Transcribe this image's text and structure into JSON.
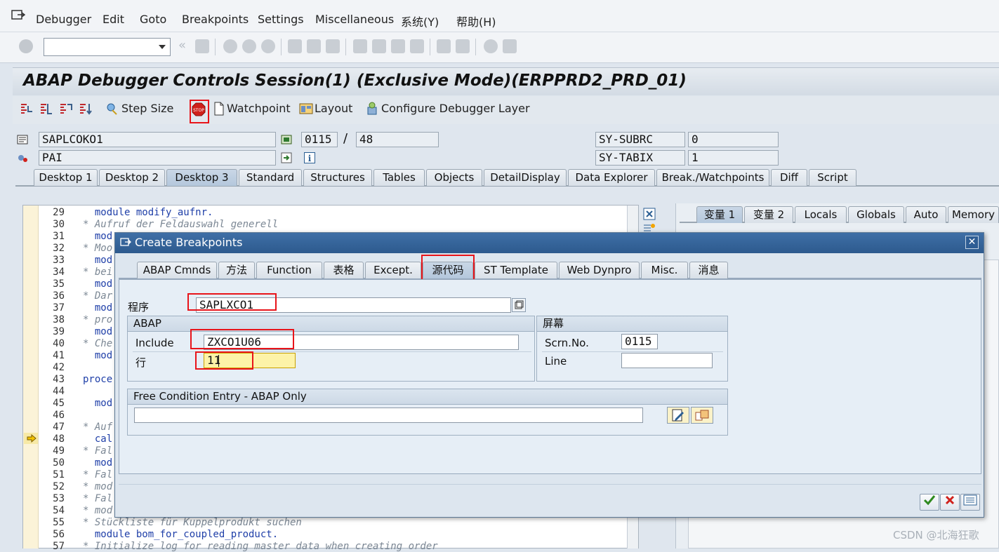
{
  "menubar": {
    "items": [
      "Debugger",
      "Edit",
      "Goto",
      "Breakpoints",
      "Settings",
      "Miscellaneous",
      "系统(Y)",
      "帮助(H)"
    ]
  },
  "toolbar": {
    "command_field": ""
  },
  "title": "ABAP Debugger Controls Session(1)  (Exclusive Mode)(ERPPRD2_PRD_01)",
  "app_toolbar": {
    "step_size": "Step Size",
    "watchpoint": "Watchpoint",
    "layout": "Layout",
    "configure": "Configure Debugger Layer"
  },
  "status": {
    "program": "SAPLCOKO1",
    "event": "PAI",
    "screen": "0115",
    "separator": "/",
    "line": "48",
    "subrc_label": "SY-SUBRC",
    "subrc_value": "0",
    "tabix_label": "SY-TABIX",
    "tabix_value": "1"
  },
  "desktop_tabs": [
    "Desktop 1",
    "Desktop 2",
    "Desktop 3",
    "Standard",
    "Structures",
    "Tables",
    "Objects",
    "DetailDisplay",
    "Data Explorer",
    "Break./Watchpoints",
    "Diff",
    "Script"
  ],
  "var_tabs": [
    "变量 1",
    "变量 2",
    "Locals",
    "Globals",
    "Auto",
    "Memory"
  ],
  "code": {
    "line_numbers": [
      "29",
      "30",
      "31",
      "32",
      "33",
      "34",
      "35",
      "36",
      "37",
      "38",
      "39",
      "40",
      "41",
      "42",
      "43",
      "44",
      "45",
      "46",
      "47",
      "48",
      "49",
      "50",
      "51",
      "52",
      "53",
      "54",
      "55",
      "56",
      "57"
    ],
    "lines": [
      "  module modify_aufnr.",
      "* Aufruf der Feldauswahl generell",
      "  mod",
      "* Moo",
      "  mod",
      "* bei",
      "  mod",
      "* Dar",
      "  mod",
      "* pro",
      "  mod",
      "* Che",
      "  mod",
      "",
      "proce",
      "",
      "  mod",
      "",
      "* Auf",
      "  cal",
      "* Fal",
      "  mod",
      "* Fal",
      "* mod",
      "* Fal",
      "* mod",
      "* Stückliste für Kuppelprodukt suchen",
      "  module bom_for_coupled_product.",
      "* Initialize log for reading master data when creating order"
    ]
  },
  "dialog": {
    "title": "Create Breakpoints",
    "close": "✕",
    "tabs": [
      "ABAP Cmnds",
      "方法",
      "Function",
      "表格",
      "Except.",
      "源代码",
      "ST Template",
      "Web Dynpro",
      "Misc.",
      "消息"
    ],
    "program_label": "程序",
    "program_value": "SAPLXCO1",
    "abap_group": "ABAP",
    "include_label": "Include",
    "include_value": "ZXCO1U06",
    "line_label": "行",
    "line_value": "11",
    "screen_group": "屏幕",
    "scrn_label": "Scrn.No.",
    "scrn_value": "0115",
    "scrn_line_label": "Line",
    "scrn_line_value": "",
    "free_condition_label": "Free Condition Entry - ABAP Only",
    "free_condition_value": ""
  },
  "watermark": "CSDN @北海狂歌"
}
